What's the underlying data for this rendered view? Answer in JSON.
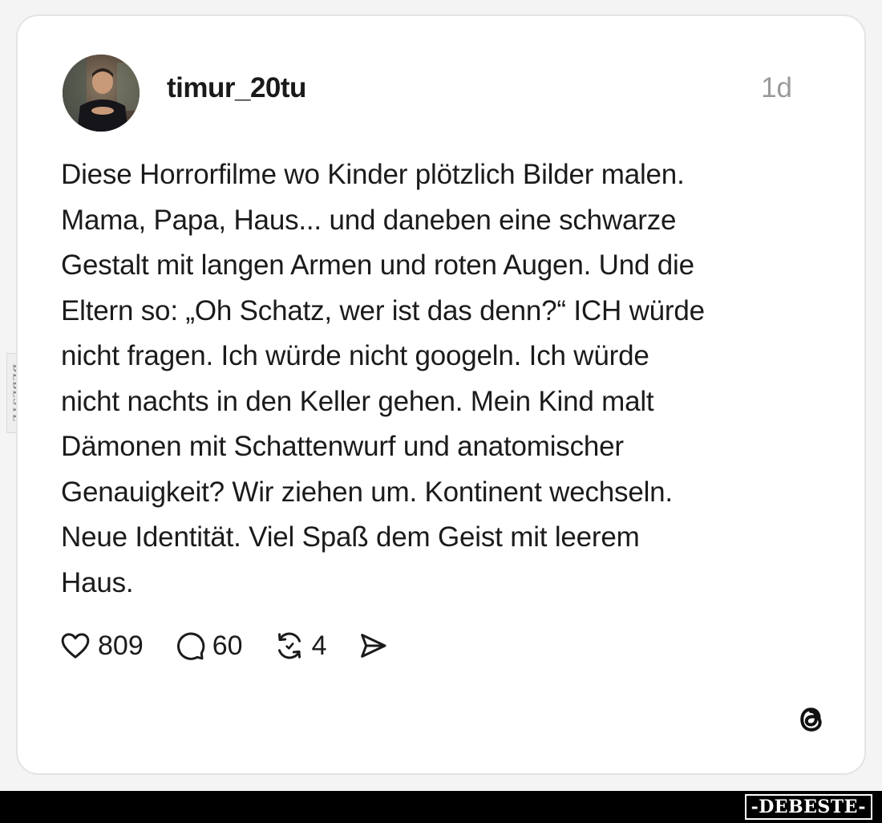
{
  "post": {
    "username": "timur_20tu",
    "time": "1d",
    "text": "Diese Horrorfilme wo Kinder plötzlich Bilder malen.\nMama, Papa, Haus... und daneben eine schwarze\nGestalt mit langen Armen und roten Augen. Und die\nEltern so: „Oh Schatz, wer ist das denn?“ ICH würde\nnicht fragen. Ich würde nicht googeln. Ich würde\nnicht nachts in den Keller gehen. Mein Kind malt\nDämonen mit Schattenwurf und anatomischer\nGenauigkeit? Wir ziehen um. Kontinent wechseln.\nNeue Identität. Viel Spaß dem Geist mit leerem\nHaus."
  },
  "actions": {
    "likes": "809",
    "comments": "60",
    "reposts": "4",
    "like_icon": "heart-icon",
    "comment_icon": "comment-bubble-icon",
    "repost_icon": "repost-icon",
    "share_icon": "send-icon"
  },
  "branding": {
    "app_icon": "threads-logo-icon",
    "side_watermark": "DEBESTE",
    "bottom_watermark": "-DEBESTE-"
  }
}
